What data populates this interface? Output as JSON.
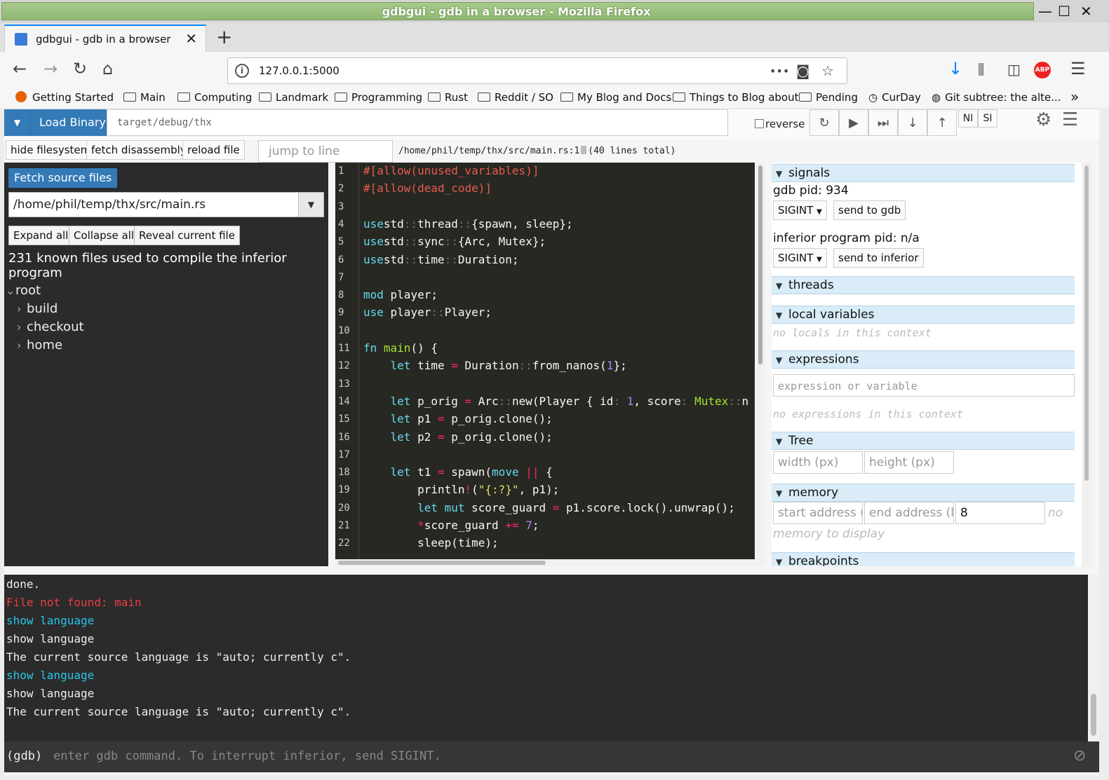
{
  "window": {
    "title": "gdbgui - gdb in a browser - Mozilla Firefox"
  },
  "tab": {
    "title": "gdbgui - gdb in a browser",
    "close": "✕",
    "new": "+"
  },
  "nav": {
    "url": "127.0.0.1:5000",
    "info": "i",
    "back": "←",
    "forward": "→",
    "reload": "↻",
    "home": "⌂",
    "more": "•••",
    "star": "☆",
    "download": "↓",
    "menu": "☰"
  },
  "bookmarks": [
    "Getting Started",
    "Main",
    "Computing",
    "Landmark",
    "Programming",
    "Rust",
    "Reddit / SO",
    "My Blog and Docs",
    "Things to Blog about",
    "Pending",
    "CurDay",
    "Git subtree: the alte..."
  ],
  "toolbar": {
    "load_label": "Load Binary",
    "binary": "target/debug/thx",
    "reverse": "reverse",
    "ni": "NI",
    "si": "SI",
    "dropdown": "▼"
  },
  "toolbar2": {
    "hide_fs": "hide filesystem",
    "fetch_dis": "fetch disassembly",
    "reload": "reload file",
    "jump_placeholder": "jump to line",
    "path": "/home/phil/temp/thx/src/main.rs:1",
    "total": "(40 lines total)"
  },
  "left": {
    "fetch": "Fetch source files",
    "selected_file": "/home/phil/temp/thx/src/main.rs",
    "expand": "Expand all",
    "collapse": "Collapse all",
    "reveal": "Reveal current file",
    "known": "231 known files used to compile the inferior program",
    "tree": [
      "root",
      "build",
      "checkout",
      "home"
    ]
  },
  "code": {
    "line_numbers": [
      "1",
      "2",
      "3",
      "4",
      "5",
      "6",
      "7",
      "8",
      "9",
      "10",
      "11",
      "12",
      "13",
      "14",
      "15",
      "16",
      "17",
      "18",
      "19",
      "20",
      "21",
      "22"
    ],
    "lines": [
      [
        [
          "a",
          "#[allow(unused_variables)]"
        ]
      ],
      [
        [
          "a",
          "#[allow(dead_code)]"
        ]
      ],
      [],
      [
        [
          "k",
          "use"
        ],
        [
          "",
          "std"
        ],
        [
          "m",
          "::"
        ],
        [
          "",
          "thread"
        ],
        [
          "m",
          "::"
        ],
        [
          "",
          "{spawn, sleep};"
        ]
      ],
      [
        [
          "k",
          "use"
        ],
        [
          "",
          "std"
        ],
        [
          "m",
          "::"
        ],
        [
          "",
          "sync"
        ],
        [
          "m",
          "::"
        ],
        [
          "",
          "{Arc, Mutex};"
        ]
      ],
      [
        [
          "k",
          "use"
        ],
        [
          "",
          "std"
        ],
        [
          "m",
          "::"
        ],
        [
          "",
          "time"
        ],
        [
          "m",
          "::"
        ],
        [
          "",
          "Duration;"
        ]
      ],
      [],
      [
        [
          "k",
          "mod"
        ],
        [
          "",
          " player;"
        ]
      ],
      [
        [
          "k",
          "use"
        ],
        [
          "",
          " player"
        ],
        [
          "m",
          "::"
        ],
        [
          "",
          "Player;"
        ]
      ],
      [],
      [
        [
          "k",
          "fn"
        ],
        [
          "",
          " "
        ],
        [
          "g",
          "main"
        ],
        [
          "",
          "() {"
        ]
      ],
      [
        [
          "",
          "    "
        ],
        [
          "k",
          "let"
        ],
        [
          "",
          " time "
        ],
        [
          "r",
          "="
        ],
        [
          "",
          " Duration"
        ],
        [
          "m",
          "::"
        ],
        [
          "",
          "from_nanos("
        ],
        [
          "n",
          "1"
        ],
        [
          "",
          "};"
        ]
      ],
      [],
      [
        [
          "",
          "    "
        ],
        [
          "k",
          "let"
        ],
        [
          "",
          " p_orig "
        ],
        [
          "r",
          "="
        ],
        [
          "",
          " Arc"
        ],
        [
          "m",
          "::"
        ],
        [
          "",
          "new(Player { id"
        ],
        [
          "m",
          ":"
        ],
        [
          "",
          " "
        ],
        [
          "n",
          "1"
        ],
        [
          "",
          ", score"
        ],
        [
          "m",
          ":"
        ],
        [
          "",
          " "
        ],
        [
          "g",
          "Mutex"
        ],
        [
          "m",
          "::"
        ],
        [
          "",
          "n"
        ]
      ],
      [
        [
          "",
          "    "
        ],
        [
          "k",
          "let"
        ],
        [
          "",
          " p1 "
        ],
        [
          "r",
          "="
        ],
        [
          "",
          " p_orig.clone();"
        ]
      ],
      [
        [
          "",
          "    "
        ],
        [
          "k",
          "let"
        ],
        [
          "",
          " p2 "
        ],
        [
          "r",
          "="
        ],
        [
          "",
          " p_orig.clone();"
        ]
      ],
      [],
      [
        [
          "",
          "    "
        ],
        [
          "k",
          "let"
        ],
        [
          "",
          " t1 "
        ],
        [
          "r",
          "="
        ],
        [
          "",
          " spawn("
        ],
        [
          "k",
          "move"
        ],
        [
          "",
          " "
        ],
        [
          "r",
          "||"
        ],
        [
          "",
          " {"
        ]
      ],
      [
        [
          "",
          "        println"
        ],
        [
          "r",
          "!"
        ],
        [
          "",
          "("
        ],
        [
          "y",
          "\"{:?}\""
        ],
        [
          "",
          ", p1);"
        ]
      ],
      [
        [
          "",
          "        "
        ],
        [
          "k",
          "let mut"
        ],
        [
          "",
          " score_guard "
        ],
        [
          "r",
          "="
        ],
        [
          "",
          " p1.score.lock().unwrap();"
        ]
      ],
      [
        [
          "",
          "        "
        ],
        [
          "r",
          "*"
        ],
        [
          "",
          "score_guard "
        ],
        [
          "r",
          "+="
        ],
        [
          "",
          " "
        ],
        [
          "n",
          "7"
        ],
        [
          "",
          ";"
        ]
      ],
      [
        [
          "",
          "        sleep(time);"
        ]
      ]
    ]
  },
  "right": {
    "signals": "signals",
    "gdb_pid": "gdb pid: 934",
    "sigint": "SIGINT",
    "send_gdb": "send to gdb",
    "inferior_pid": "inferior program pid: n/a",
    "send_inferior": "send to inferior",
    "threads": "threads",
    "locals": "local variables",
    "no_locals": "no locals in this context",
    "expressions": "expressions",
    "expr_placeholder": "expression or variable",
    "no_expr": "no expressions in this context",
    "tree": "Tree",
    "width_ph": "width (px)",
    "height_ph": "height (px)",
    "memory": "memory",
    "start_ph": "start address (",
    "end_ph": "end address (l",
    "mem_bytes": "8",
    "no_mem": "no",
    "no_mem2": "memory to display",
    "breakpoints": "breakpoints"
  },
  "console": {
    "lines": [
      {
        "t": "done.",
        "c": ""
      },
      {
        "t": "File not found: main",
        "c": "red"
      },
      {
        "t": "show language",
        "c": "cyan"
      },
      {
        "t": "show language",
        "c": ""
      },
      {
        "t": "The current source language is \"auto; currently c\".",
        "c": ""
      },
      {
        "t": "show language",
        "c": "cyan"
      },
      {
        "t": "show language",
        "c": ""
      },
      {
        "t": "The current source language is \"auto; currently c\".",
        "c": ""
      }
    ],
    "prompt": "(gdb)",
    "placeholder": "enter gdb command. To interrupt inferior, send SIGINT."
  }
}
